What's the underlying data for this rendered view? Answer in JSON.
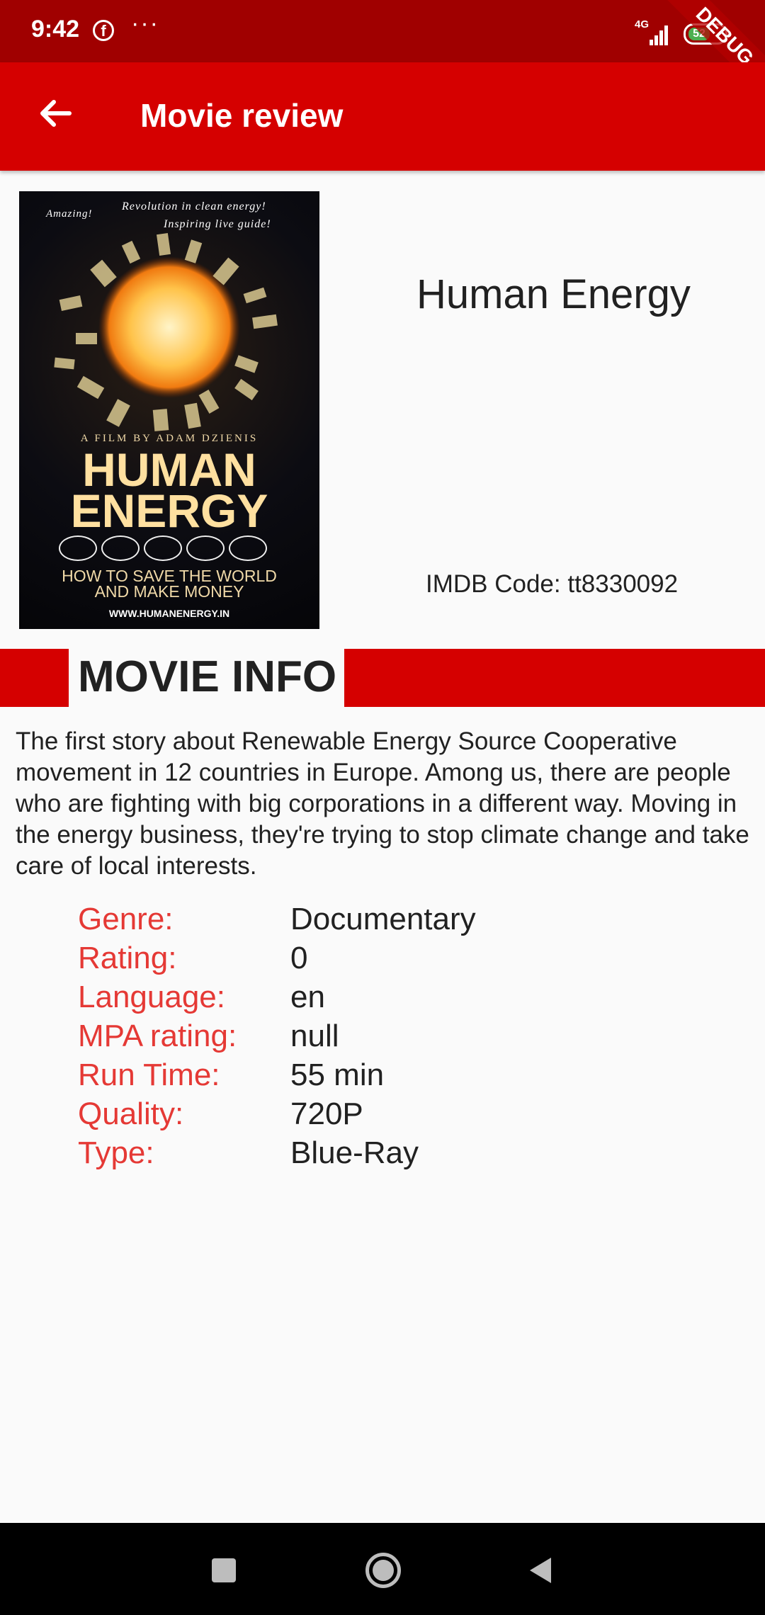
{
  "status_bar": {
    "time": "9:42",
    "notification_icons": [
      "facebook-icon",
      "more-dots-icon"
    ],
    "network": "4G",
    "battery_level": "52",
    "debug_banner": "DEBUG"
  },
  "app_bar": {
    "title": "Movie review",
    "back_icon": "arrow-back-icon"
  },
  "poster": {
    "quote_left": "Amazing!",
    "quote_top": "Revolution in clean energy!",
    "quote_top2": "Inspiring live guide!",
    "credit": "A FILM BY ADAM DZIENIS",
    "title_line1": "HUMAN",
    "title_line2": "ENERGY",
    "tagline_line1": "HOW TO SAVE THE WORLD",
    "tagline_line2": "AND MAKE MONEY",
    "url": "WWW.HUMANENERGY.IN"
  },
  "movie": {
    "title": "Human Energy",
    "imdb_code": "IMDB Code: tt8330092",
    "info_heading": "MOVIE INFO",
    "description": "The first story about Renewable Energy Source Cooperative movement in 12 countries in Europe. Among us, there are people who are fighting with big corporations in a different way. Moving in the energy business, they're trying to stop climate change and take care of local interests.",
    "details": [
      {
        "label": "Genre:",
        "value": "Documentary"
      },
      {
        "label": "Rating:",
        "value": "0"
      },
      {
        "label": "Language:",
        "value": "en"
      },
      {
        "label": "MPA rating:",
        "value": "null"
      },
      {
        "label": "Run Time:",
        "value": "55 min"
      },
      {
        "label": "Quality:",
        "value": "720P"
      },
      {
        "label": "Type:",
        "value": "Blue-Ray"
      }
    ]
  },
  "nav_bar": {
    "buttons": [
      "recents-square-icon",
      "home-circle-icon",
      "back-triangle-icon"
    ]
  },
  "colors": {
    "status_bar": "#a00000",
    "app_bar": "#d50000",
    "label": "#e53935",
    "text": "#212121"
  }
}
